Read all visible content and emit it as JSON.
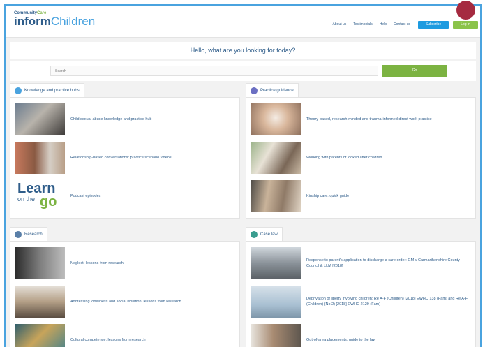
{
  "header": {
    "logo_small": "Community",
    "logo_small_accent": "Care",
    "logo_inform": "inform",
    "logo_children": "Children",
    "nav": [
      "About us",
      "Testimonials",
      "Help",
      "Contact us"
    ],
    "subscribe_label": "Subscribe",
    "login_label": "Log in"
  },
  "hello_text": "Hello, what are you looking for today?",
  "search": {
    "placeholder": "Search",
    "button_label": "Go"
  },
  "sections": {
    "knowledge": {
      "tab_label": "Knowledge and practice hubs",
      "items": [
        "Child sexual abuse knowledge and practice hub",
        "Relationship-based conversations: practice scenario videos",
        "Podcast episodes"
      ]
    },
    "guidance": {
      "tab_label": "Practice guidance",
      "items": [
        "Theory-based, research-minded and trauma-informed direct work practice",
        "Working with parents of looked after children",
        "Kinship care: quick guide"
      ]
    },
    "research": {
      "tab_label": "Research",
      "items": [
        "Neglect: lessons from research",
        "Addressing loneliness and social isolation: lessons from research",
        "Cultural competence: lessons from research"
      ]
    },
    "caselaw": {
      "tab_label": "Case law",
      "items": [
        "Response to parent's application to discharge a care order: GM v Carmarthenshire County Council & LLM [2018]",
        "Deprivation of liberty involving children: Re A-F (Children) [2018] EWHC 138 (Fam) and Re A-F (Children) (No.2) [2018] EWHC 2129 (Fam)",
        "Out-of-area placements: guide to the law"
      ]
    }
  },
  "colors": {
    "brand_blue": "#2f5d8a",
    "accent_green": "#7cb342",
    "subscribe_blue": "#1d9be0",
    "frame_blue": "#4aa3df",
    "marker_red": "#a52a40"
  },
  "learn_logo": {
    "line1": "Learn",
    "line2": "on the",
    "line3": "go"
  }
}
